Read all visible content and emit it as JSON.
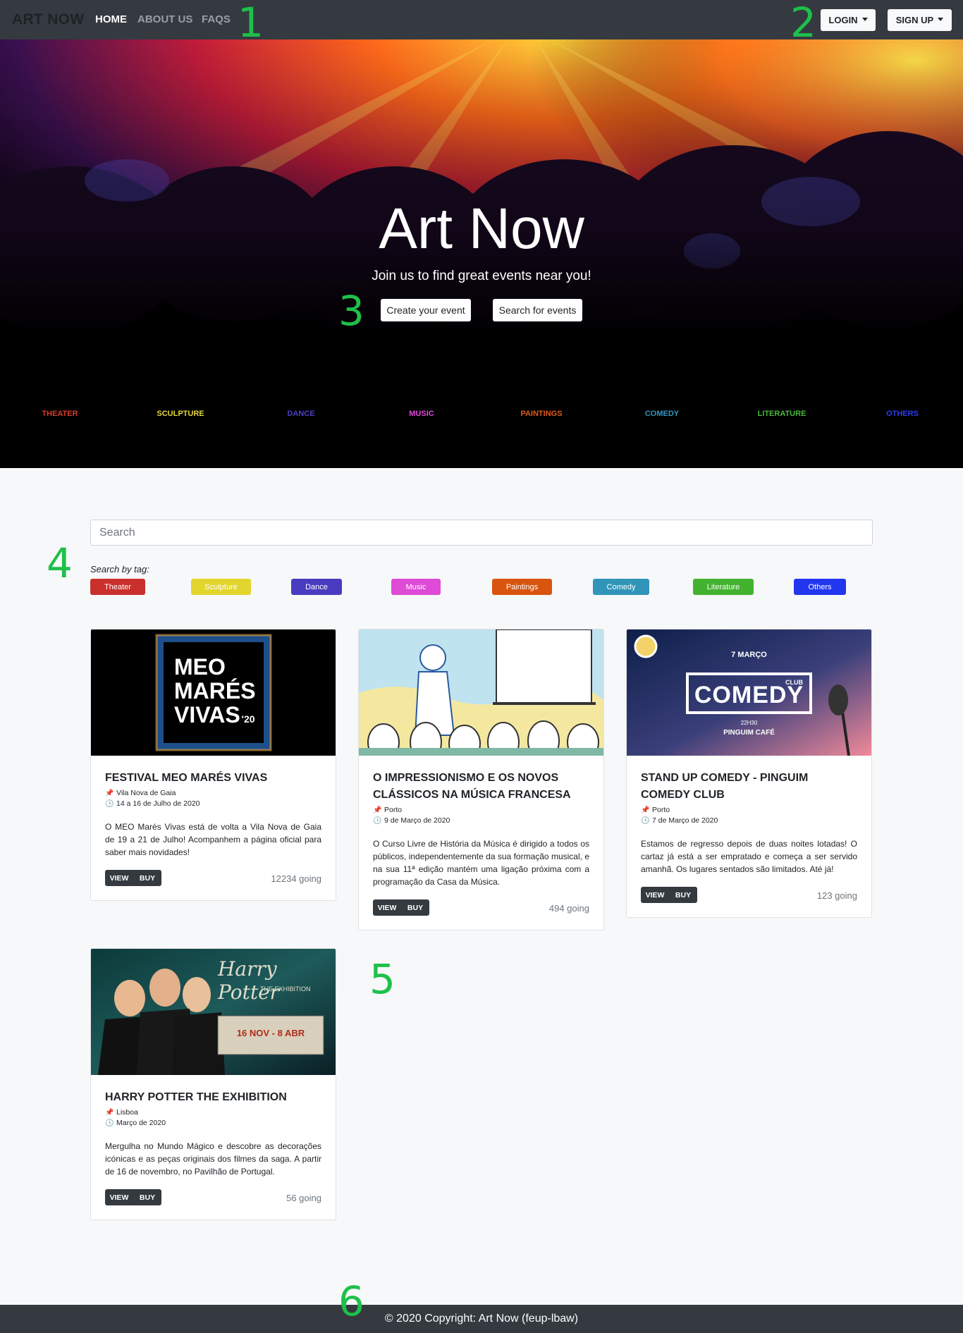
{
  "nav": {
    "brand": "ART NOW",
    "links": [
      "HOME",
      "ABOUT US",
      "FAQS"
    ],
    "login": "LOGIN",
    "signup": "SIGN UP"
  },
  "annotations": [
    "1",
    "2",
    "3",
    "4",
    "5",
    "6"
  ],
  "hero": {
    "title": "Art Now",
    "subtitle": "Join us to find great events near you!",
    "create_button": "Create your event",
    "search_button": "Search for events",
    "categories": [
      {
        "label": "THEATER",
        "color": "#d63b2a"
      },
      {
        "label": "SCULPTURE",
        "color": "#e2d83a"
      },
      {
        "label": "DANCE",
        "color": "#4a3fc4"
      },
      {
        "label": "MUSIC",
        "color": "#d94ad7"
      },
      {
        "label": "PAINTINGS",
        "color": "#e05a1c"
      },
      {
        "label": "COMEDY",
        "color": "#3498c0"
      },
      {
        "label": "LITERATURE",
        "color": "#48b83a"
      },
      {
        "label": "OTHERS",
        "color": "#2a3bea"
      }
    ]
  },
  "search": {
    "placeholder": "Search",
    "tag_label": "Search by tag:",
    "tags": [
      {
        "label": "Theater",
        "color": "#c9302c"
      },
      {
        "label": "Sculpture",
        "color": "#e2d52d"
      },
      {
        "label": "Dance",
        "color": "#4a3cc0"
      },
      {
        "label": "Music",
        "color": "#de4bd6"
      },
      {
        "label": "Paintings",
        "color": "#d9540f"
      },
      {
        "label": "Comedy",
        "color": "#3195b9"
      },
      {
        "label": "Literature",
        "color": "#43b22f"
      },
      {
        "label": "Others",
        "color": "#2236f0"
      }
    ]
  },
  "events": [
    {
      "title": "FESTIVAL MEO MARÉS VIVAS",
      "location": "Vila Nova de Gaia",
      "date": "14 a 16 de Julho de 2020",
      "description": "O MEO Marés Vivas está de volta a Vila Nova de Gaia de 19 a 21 de Julho! Acompanhem a página oficial para saber mais novidades!",
      "view": "VIEW",
      "buy": "BUY",
      "going": "12234 going",
      "image_text": [
        "MEO",
        "MARÉS",
        "VIVAS",
        "'20"
      ]
    },
    {
      "title": "O IMPRESSIONISMO E OS NOVOS CLÁSSICOS NA MÚSICA FRANCESA",
      "location": "Porto",
      "date": "9 de Março de 2020",
      "description": "O Curso Livre de História da Música é dirigido a todos os públicos, independentemente da sua formação musical, e na sua 11ª edição mantém uma ligação próxima com a programação da Casa da Música.",
      "view": "VIEW",
      "buy": "BUY",
      "going": "494 going"
    },
    {
      "title": "STAND UP COMEDY - PINGUIM COMEDY CLUB",
      "location": "Porto",
      "date": "7 de Março de 2020",
      "description": "Estamos de regresso depois de duas noites lotadas! O cartaz já está a ser empratado e começa a ser servido amanhã. Os lugares sentados são limitados. Até já!",
      "view": "VIEW",
      "buy": "BUY",
      "going": "123 going",
      "image_text": [
        "7 MARÇO",
        "CLUB",
        "COMEDY",
        "22H30",
        "PINGUIM CAFÉ"
      ]
    },
    {
      "title": "HARRY POTTER THE EXHIBITION",
      "location": "Lisboa",
      "date": "Março de 2020",
      "description": "Mergulha no Mundo Mágico e descobre as decorações icónicas e as peças originais dos filmes da saga. A partir de 16 de novembro, no Pavilhão de Portugal.",
      "view": "VIEW",
      "buy": "BUY",
      "going": "56 going",
      "image_text": [
        "Harry Potter",
        "THE EXHIBITION",
        "16 NOV - 8 ABR"
      ]
    }
  ],
  "icons": {
    "location": "pushpin-icon",
    "date": "clock-icon"
  },
  "footer": {
    "copyright": "© 2020 Copyright: Art Now (feup-lbaw)"
  }
}
